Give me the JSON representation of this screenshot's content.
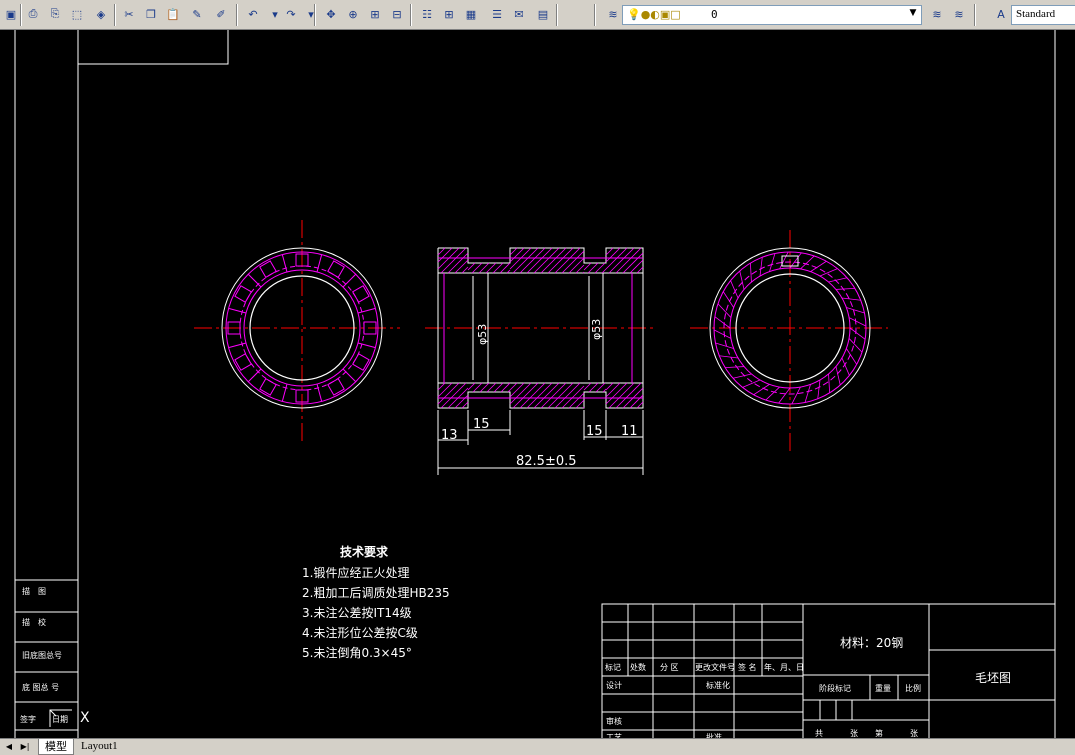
{
  "toolbar": {
    "icons": [
      "save-icon",
      "print-icon",
      "print-preview-icon",
      "publish-icon",
      "3d-dwf-icon",
      "cut-icon",
      "copy-icon",
      "paste-icon",
      "match-properties-icon",
      "block-editor-icon",
      "undo-icon",
      "undo-dropdown-icon",
      "redo-icon",
      "redo-dropdown-icon",
      "pan-icon",
      "zoom-realtime-icon",
      "zoom-window-icon",
      "zoom-previous-icon",
      "properties-icon",
      "design-center-icon",
      "tool-palettes-icon",
      "sheet-set-icon",
      "markup-icon",
      "quickcalc-icon",
      "help-icon",
      "layer-properties-icon",
      "layer-previous-icon",
      "layer-states-icon",
      "text-style-icon"
    ],
    "layer_value": "0",
    "text_style": "Standard"
  },
  "drawing": {
    "dimensions": {
      "bore_left": "φ53",
      "bore_right": "φ53",
      "d13": "13",
      "d15_left": "15",
      "d15_right": "15",
      "d11": "11",
      "overall": "82.5±0.5"
    },
    "tech_requirements": {
      "title": "技术要求",
      "items": [
        "1.锻件应经正火处理",
        "2.粗加工后调质处理HB235",
        "3.未注公差按IT14级",
        "4.未注形位公差按C级",
        "5.未注倒角0.3×45°"
      ]
    },
    "left_block": [
      "描　图",
      "描　校",
      "旧底图总号",
      "底 图总 号",
      "签字",
      "日期"
    ],
    "title_block": {
      "material": "材料：20钢",
      "drawing_name": "毛坯图",
      "header_cells": [
        "标记",
        "处数",
        "分 区",
        "更改文件号",
        "签 名",
        "年、月、日"
      ],
      "design": "设计",
      "standardize": "标准化",
      "stage_mark": "阶段标记",
      "weight": "重量",
      "scale": "比例",
      "review": "审核",
      "process": "工艺",
      "approve": "批准",
      "total": "共",
      "sheet": "张",
      "nth": "第",
      "sheet2": "张"
    },
    "ucs_label": "X",
    "colors": {
      "red": "#ff0000",
      "magenta": "#ff00ff",
      "white": "#ffffff",
      "pink": "#e0b0b0"
    }
  },
  "tabs": {
    "model": "模型",
    "layout1": "Layout1"
  }
}
